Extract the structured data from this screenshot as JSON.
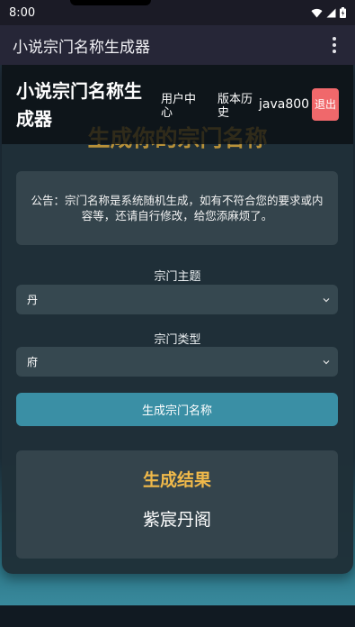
{
  "status_bar": {
    "time": "8:00"
  },
  "app_bar": {
    "title": "小说宗门名称生成器",
    "menu_icon": "more-vert-icon"
  },
  "site": {
    "title": "小说宗门名称生成器",
    "nav_user": "用户中心",
    "nav_history": "版本历史",
    "username": "java800",
    "logout": "退出"
  },
  "hero": {
    "title": "生成你的宗门名称"
  },
  "notice": {
    "text": "公告：宗门名称是系统随机生成，如有不符合您的要求或内容等，还请自行修改，给您添麻烦了。"
  },
  "form": {
    "theme_label": "宗门主题",
    "theme_value": "丹",
    "type_label": "宗门类型",
    "type_value": "府",
    "generate_label": "生成宗门名称"
  },
  "result": {
    "heading": "生成结果",
    "name": "紫宸丹阁"
  },
  "colors": {
    "accent": "#3a8fa5",
    "logout": "#f0686b",
    "result_heading": "#f0b94a",
    "hero_title": "#c69a3a"
  }
}
